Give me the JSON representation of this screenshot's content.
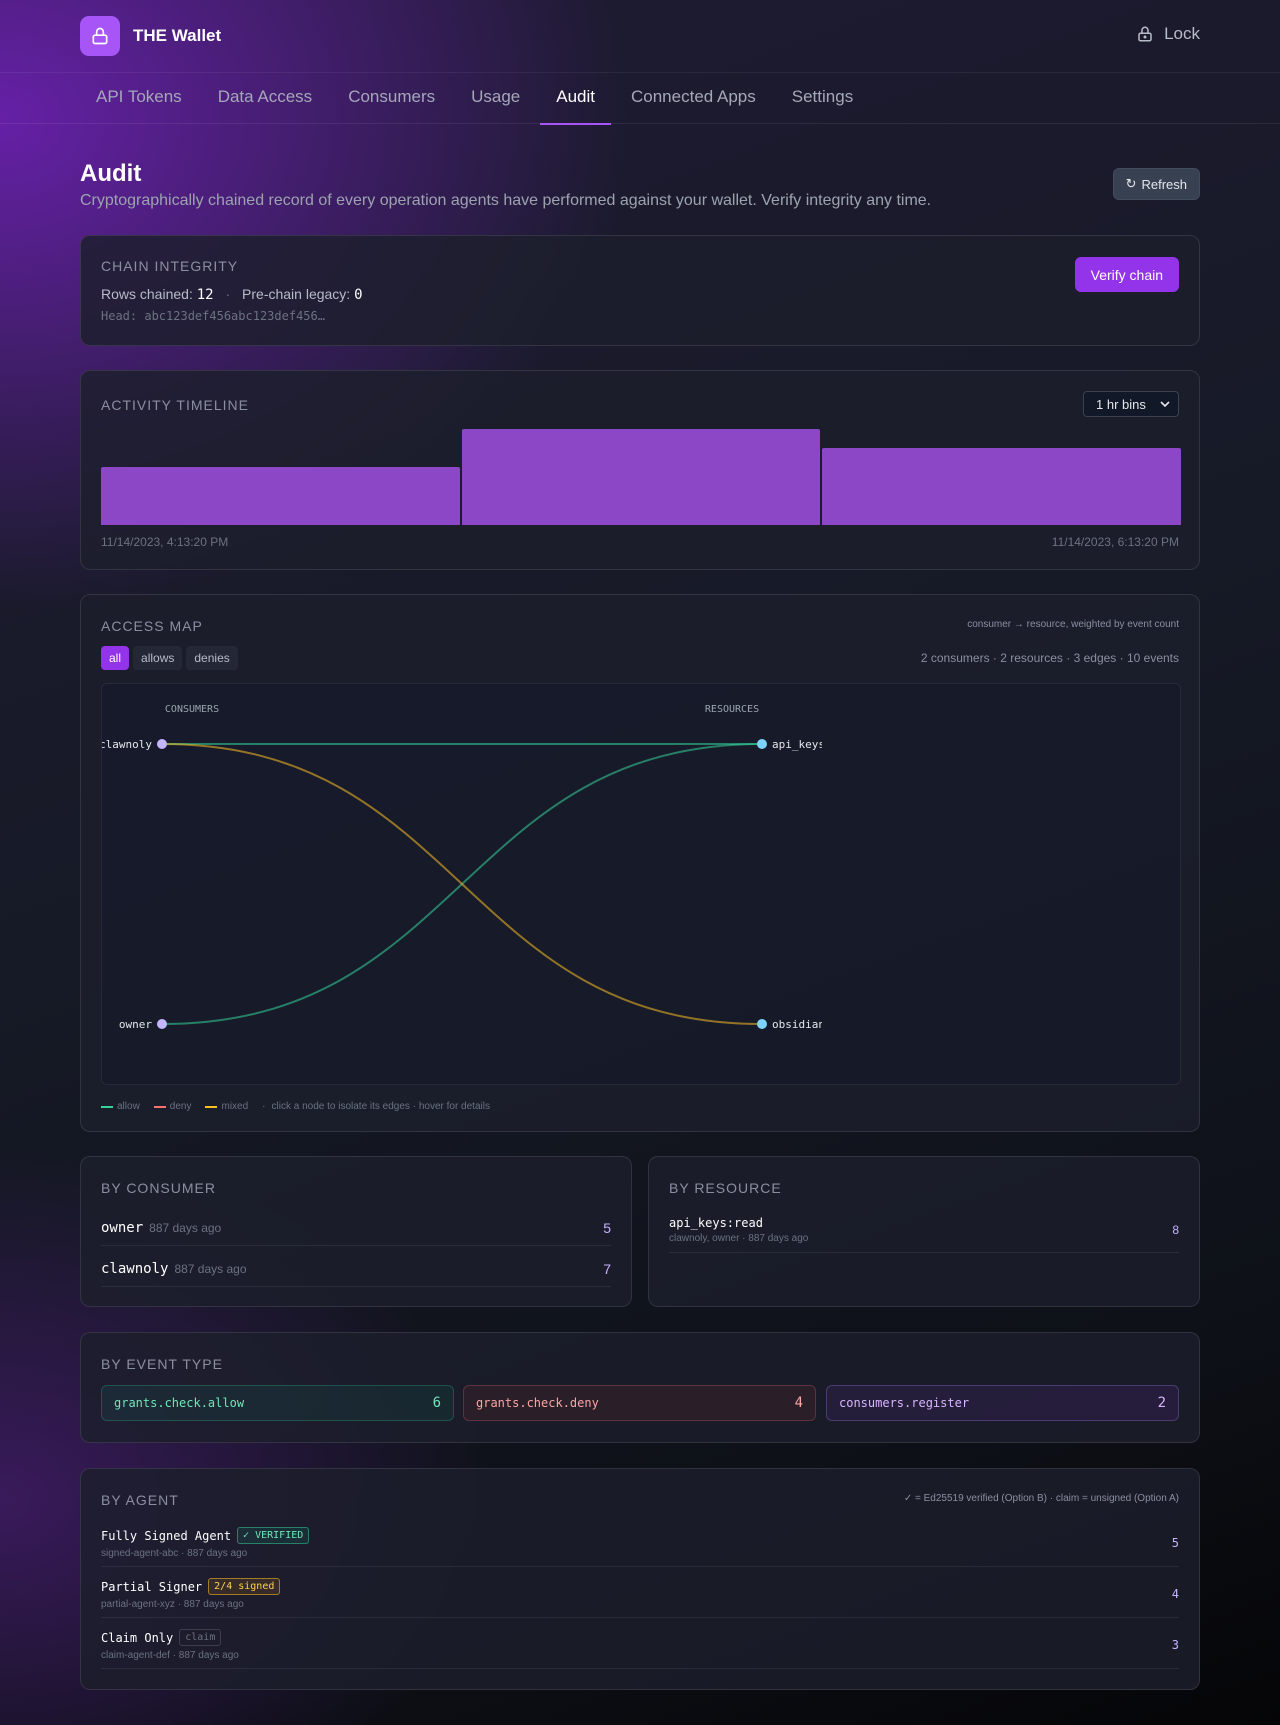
{
  "app": {
    "title": "THE Wallet",
    "lock_label": "Lock"
  },
  "tabs": [
    "API Tokens",
    "Data Access",
    "Consumers",
    "Usage",
    "Audit",
    "Connected Apps",
    "Settings"
  ],
  "active_tab": "Audit",
  "page": {
    "title": "Audit",
    "subtitle": "Cryptographically chained record of every operation agents have performed against your wallet. Verify integrity any time.",
    "refresh_label": "Refresh"
  },
  "chain_integrity": {
    "title": "CHAIN INTEGRITY",
    "rows_label": "Rows chained:",
    "rows_value": "12",
    "legacy_label": "Pre-chain legacy:",
    "legacy_value": "0",
    "head": "Head: abc123def456abc123def456…",
    "verify_label": "Verify chain"
  },
  "timeline": {
    "title": "ACTIVITY TIMELINE",
    "bin_select": "1 hr bins",
    "start_label": "11/14/2023, 4:13:20 PM",
    "end_label": "11/14/2023, 6:13:20 PM",
    "bins": [
      0.6,
      1.0,
      0.8
    ],
    "bar_color": "#8b47c6"
  },
  "access_map": {
    "title": "ACCESS MAP",
    "note": "consumer → resource, weighted by event count",
    "filters": [
      "all",
      "allows",
      "denies"
    ],
    "active_filter": "all",
    "summary": "2 consumers · 2 resources · 3 edges · 10 events",
    "consumers_header": "CONSUMERS",
    "resources_header": "RESOURCES",
    "consumers": [
      "clawnoly",
      "owner"
    ],
    "resources": [
      "api_keys",
      "obsidian"
    ],
    "edges": [
      {
        "from": "clawnoly",
        "to": "api_keys",
        "kind": "allow"
      },
      {
        "from": "owner",
        "to": "api_keys",
        "kind": "allow"
      },
      {
        "from": "clawnoly",
        "to": "obsidian",
        "kind": "mixed"
      }
    ],
    "colors": {
      "allow": "#34d399",
      "deny": "#f87171",
      "mixed": "#fbbf24",
      "consumer_node": "#c4b5fd",
      "resource_node": "#7dd3fc"
    },
    "legend": {
      "allow": "allow",
      "deny": "deny",
      "mixed": "mixed",
      "hint": "click a node to isolate its edges · hover for details"
    }
  },
  "by_consumer": {
    "title": "BY CONSUMER",
    "rows": [
      {
        "name": "owner",
        "ago": "887 days ago",
        "count": "5"
      },
      {
        "name": "clawnoly",
        "ago": "887 days ago",
        "count": "7"
      }
    ]
  },
  "by_resource": {
    "title": "BY RESOURCE",
    "rows": [
      {
        "name": "api_keys:read",
        "sub": "clawnoly, owner · 887 days ago",
        "count": "8"
      }
    ]
  },
  "by_event_type": {
    "title": "BY EVENT TYPE",
    "items": [
      {
        "name": "grants.check.allow",
        "count": "6",
        "tone": "allow"
      },
      {
        "name": "grants.check.deny",
        "count": "4",
        "tone": "deny"
      },
      {
        "name": "consumers.register",
        "count": "2",
        "tone": "neutral"
      }
    ]
  },
  "by_agent": {
    "title": "BY AGENT",
    "note": "✓ = Ed25519 verified (Option B) · claim = unsigned (Option A)",
    "rows": [
      {
        "name": "Fully Signed Agent",
        "badge": "✓ VERIFIED",
        "badge_tone": "verified",
        "sub": "signed-agent-abc · 887 days ago",
        "count": "5"
      },
      {
        "name": "Partial Signer",
        "badge": "2/4 signed",
        "badge_tone": "partial",
        "sub": "partial-agent-xyz · 887 days ago",
        "count": "4"
      },
      {
        "name": "Claim Only",
        "badge": "claim",
        "badge_tone": "claim",
        "sub": "claim-agent-def · 887 days ago",
        "count": "3"
      }
    ]
  }
}
